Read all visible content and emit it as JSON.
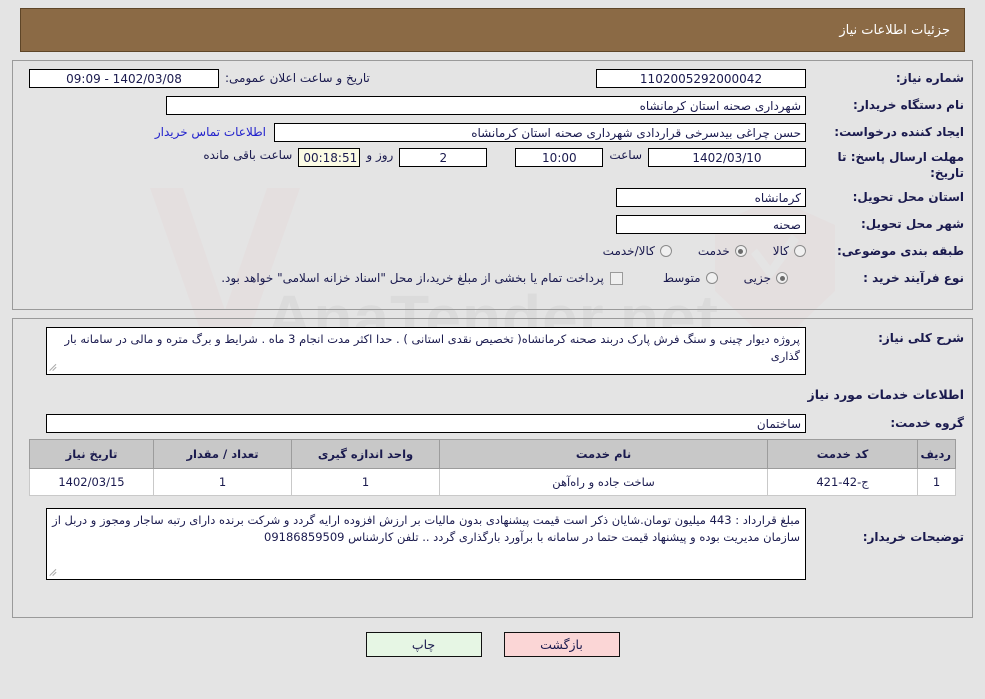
{
  "header": {
    "title": "جزئیات اطلاعات نیاز"
  },
  "top_panel": {
    "need_number_label": "شماره نیاز:",
    "need_number_value": "1102005292000042",
    "public_announce_label": "تاریخ و ساعت اعلان عمومی:",
    "public_announce_value": "09:09 - 1402/03/08",
    "buyer_org_label": "نام دستگاه خریدار:",
    "buyer_org_value": "شهرداری صحنه استان کرمانشاه",
    "requester_label": "ایجاد کننده درخواست:",
    "requester_value": "حسن چراغی بیدسرخی قراردادی شهرداری صحنه استان کرمانشاه",
    "contact_link": "اطلاعات تماس خریدار",
    "deadline_label": "مهلت ارسال پاسخ: تا تاریخ:",
    "deadline_date": "1402/03/10",
    "hour_label": "ساعت",
    "deadline_time": "10:00",
    "days_value": "2",
    "days_label": "روز و",
    "countdown_value": "00:18:51",
    "remaining_label": "ساعت باقی مانده",
    "province_label": "استان محل تحویل:",
    "province_value": "کرمانشاه",
    "city_label": "شهر محل تحویل:",
    "city_value": "صحنه",
    "category_label": "طبقه بندی موضوعی:",
    "category_options": [
      {
        "label": "کالا",
        "checked": false
      },
      {
        "label": "خدمت",
        "checked": true
      },
      {
        "label": "کالا/خدمت",
        "checked": false
      }
    ],
    "process_label": "نوع فرآیند خرید :",
    "process_options": [
      {
        "label": "جزیی",
        "checked": true
      },
      {
        "label": "متوسط",
        "checked": false
      }
    ],
    "treasury_checkbox_checked": false,
    "treasury_text": "پرداخت تمام یا بخشی از مبلغ خرید،از محل \"اسناد خزانه اسلامی\" خواهد بود."
  },
  "bottom_panel": {
    "summary_label": "شرح کلی نیاز:",
    "summary_value": "پروژه دیوار چینی و سنگ فرش پارک دربند صحنه کرمانشاه( تخصیص نقدی استانی ) . حدا اکثر مدت انجام 3 ماه . شرایط و برگ متره و مالی در سامانه بار گذاری",
    "services_heading": "اطلاعات خدمات مورد نیاز",
    "service_group_label": "گروه خدمت:",
    "service_group_value": "ساختمان",
    "table": {
      "columns": [
        "ردیف",
        "کد خدمت",
        "نام خدمت",
        "واحد اندازه گیری",
        "تعداد / مقدار",
        "تاریخ نیاز"
      ],
      "rows": [
        {
          "row": "1",
          "code": "ج-42-421",
          "name": "ساخت جاده و راه‌آهن",
          "unit": "1",
          "qty": "1",
          "date": "1402/03/15"
        }
      ]
    },
    "buyer_notes_label": "توضیحات خریدار:",
    "buyer_notes_value": "مبلغ قرارداد : 443 میلیون تومان.شایان ذکر است قیمت پیشنهادی بدون مالیات بر ارزش افزوده ارایه گردد و شرکت برنده دارای رتبه ساجار ومجوز و دربل از سازمان مدیریت بوده و  پیشنهاد قیمت حتما در سامانه با برآورد  بارگذاری گردد .. تلفن کارشناس 09186859509"
  },
  "footer": {
    "print_label": "چاپ",
    "back_label": "بازگشت"
  },
  "watermark": {
    "text": "AnaTender.net"
  },
  "colors": {
    "header_bg": "#8b6a45",
    "page_bg": "#e4e4e4",
    "table_header_bg": "#c8c8c8",
    "link": "#2222cc",
    "text": "#1a1a4e",
    "print_btn": "#e6f6e4",
    "back_btn": "#fbd6d6"
  }
}
